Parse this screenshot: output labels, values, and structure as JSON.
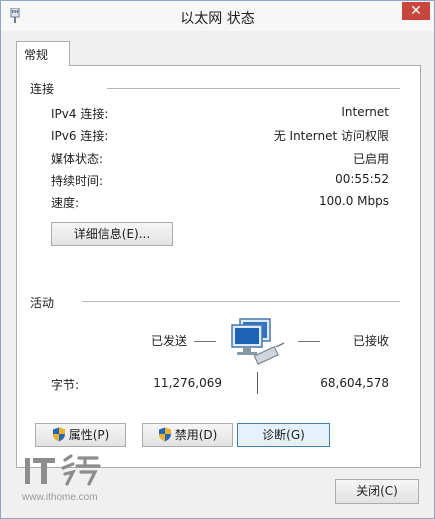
{
  "window": {
    "title": "以太网 状态",
    "close_glyph": "✕",
    "accent": "#c7463e"
  },
  "tab": {
    "label": "常规"
  },
  "connection": {
    "heading": "连接",
    "rows": [
      {
        "label": "IPv4 连接:",
        "value": "Internet"
      },
      {
        "label": "IPv6 连接:",
        "value": "无 Internet 访问权限"
      },
      {
        "label": "媒体状态:",
        "value": "已启用"
      },
      {
        "label": "持续时间:",
        "value": "00:55:52"
      },
      {
        "label": "速度:",
        "value": "100.0 Mbps"
      }
    ],
    "details_button": "详细信息(E)..."
  },
  "activity": {
    "heading": "活动",
    "sent_label": "已发送",
    "received_label": "已接收",
    "bytes_label": "字节:",
    "bytes_sent": "11,276,069",
    "bytes_received": "68,604,578",
    "network_icon": "network-computers-icon"
  },
  "buttons": {
    "properties": "属性(P)",
    "disable": "禁用(D)",
    "diagnose": "诊断(G)",
    "close": "关闭(C)"
  },
  "watermark": {
    "logo": "IT之家",
    "url": "www.ithome.com"
  }
}
